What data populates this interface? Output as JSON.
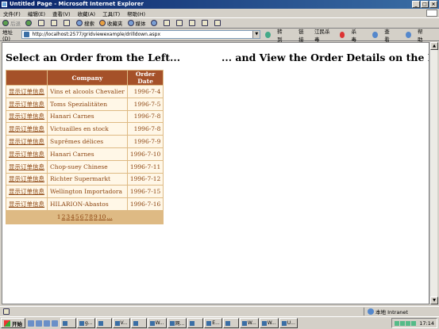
{
  "window": {
    "title": "Untitled Page - Microsoft Internet Explorer",
    "min": "_",
    "max": "□",
    "close": "×"
  },
  "menu": [
    "文件(F)",
    "编辑(E)",
    "查看(V)",
    "收藏(A)",
    "工具(T)",
    "帮助(H)"
  ],
  "toolbar": {
    "back": "后退",
    "search": "搜索",
    "favorites": "收藏夹",
    "media": "媒体"
  },
  "address": {
    "label": "地址(D)",
    "url": "http://localhost:2577/gridviewexample/drilldown.aspx",
    "go": "转到",
    "links": "链接",
    "ext1": "江民杀毒",
    "ext2": "杀毒",
    "ext3": "查看",
    "help": "帮助"
  },
  "page": {
    "heading_left": "Select an Order from the Left...",
    "heading_right": "... and View the Order Details on the Right",
    "grid": {
      "columns": [
        "",
        "Company",
        "Order Date"
      ],
      "select_label": "显示订单信息",
      "rows": [
        {
          "company": "Vins et alcools Chevalier",
          "date": "1996-7-4"
        },
        {
          "company": "Toms Spezialitäten",
          "date": "1996-7-5"
        },
        {
          "company": "Hanari Carnes",
          "date": "1996-7-8"
        },
        {
          "company": "Victuailles en stock",
          "date": "1996-7-8"
        },
        {
          "company": "Suprêmes délices",
          "date": "1996-7-9"
        },
        {
          "company": "Hanari Carnes",
          "date": "1996-7-10"
        },
        {
          "company": "Chop-suey Chinese",
          "date": "1996-7-11"
        },
        {
          "company": "Richter Supermarkt",
          "date": "1996-7-12"
        },
        {
          "company": "Wellington Importadora",
          "date": "1996-7-15"
        },
        {
          "company": "HILARION-Abastos",
          "date": "1996-7-16"
        }
      ],
      "pager": {
        "current": "1",
        "links": [
          "2",
          "3",
          "4",
          "5",
          "6",
          "7",
          "8",
          "9",
          "10",
          "..."
        ]
      }
    }
  },
  "status": {
    "zone": "本地 Intranet"
  },
  "taskbar": {
    "start": "开始",
    "tasks": [
      "",
      "g...",
      "",
      "V...",
      "",
      "W...",
      "网...",
      "",
      "E...",
      "",
      "W...",
      "W...",
      "U..."
    ],
    "clock": "17:14"
  }
}
